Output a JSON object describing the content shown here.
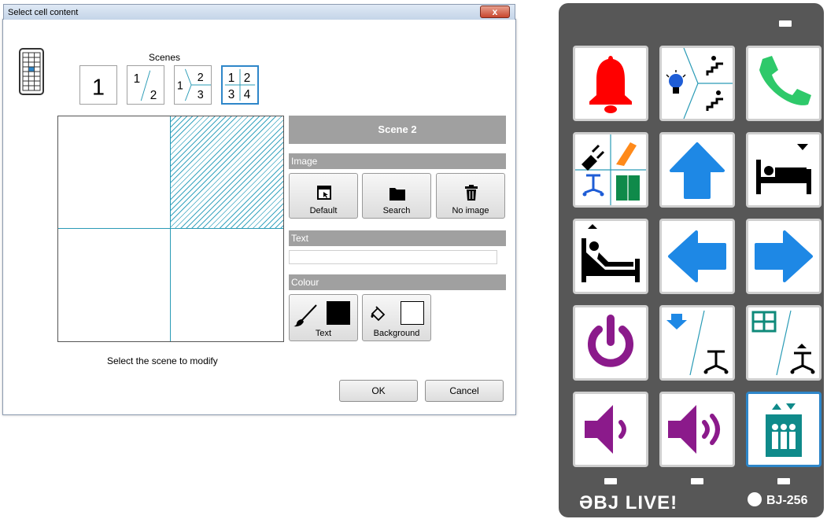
{
  "dialog": {
    "title": "Select cell content",
    "close_label": "x",
    "scenes_label": "Scenes",
    "scene_buttons": [
      {
        "name": "scene-1-button",
        "digits": [
          "1"
        ]
      },
      {
        "name": "scene-2-button",
        "digits": [
          "1",
          "2"
        ]
      },
      {
        "name": "scene-3-button",
        "digits": [
          "1",
          "2",
          "3"
        ]
      },
      {
        "name": "scene-4-button",
        "digits": [
          "1",
          "2",
          "3",
          "4"
        ]
      }
    ],
    "hint": "Select the scene to modify",
    "scene_header": "Scene 2",
    "image_section": {
      "title": "Image",
      "buttons": [
        "Default",
        "Search",
        "No image"
      ]
    },
    "text_section": {
      "title": "Text",
      "value": ""
    },
    "colour_section": {
      "title": "Colour",
      "buttons": [
        "Text",
        "Background"
      ],
      "text_color": "#000000",
      "background_color": "#ffffff"
    },
    "ok_label": "OK",
    "cancel_label": "Cancel"
  },
  "device": {
    "brand": "ƏBJ LIVE!",
    "model": "BJ-256",
    "keys": [
      {
        "name": "bell-icon"
      },
      {
        "name": "light-stairs-icon"
      },
      {
        "name": "phone-icon"
      },
      {
        "name": "multi-device-icon"
      },
      {
        "name": "arrow-up-icon"
      },
      {
        "name": "bed-icon"
      },
      {
        "name": "bed-recline-icon"
      },
      {
        "name": "arrow-left-icon"
      },
      {
        "name": "arrow-right-icon"
      },
      {
        "name": "power-icon"
      },
      {
        "name": "arrow-down-table-icon"
      },
      {
        "name": "window-table-icon"
      },
      {
        "name": "volume-down-icon"
      },
      {
        "name": "volume-up-icon"
      },
      {
        "name": "elevator-icon"
      }
    ]
  }
}
